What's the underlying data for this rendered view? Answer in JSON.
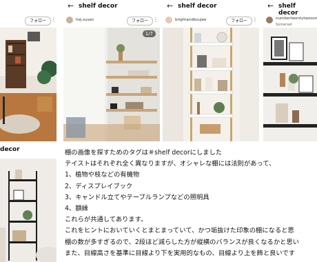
{
  "cards": [
    {
      "title": "",
      "user": "",
      "follow": "フォロー"
    },
    {
      "title": "shelf decor",
      "user": "hej.susan",
      "follow": "フォロー",
      "page_indicator": "1/7"
    },
    {
      "title": "shelf decor",
      "user": "brightandboujee",
      "follow": "フォロー"
    },
    {
      "title": "shelf decor",
      "user": "numbertwentytwosomers",
      "location": "Somerset",
      "follow": "フォロー"
    },
    {
      "title": "decor",
      "user": ""
    }
  ],
  "article": {
    "lines": [
      "棚の画像を探すためのタグは＃shelf decorにしました",
      "テイストはそれぞれ全く異なりますが、オシャレな棚には法則があって、",
      "1、植物や枝などの有機物",
      "2、ディスプレイブック",
      "3、キャンドル立てやテーブルランプなどの照明具",
      "4、額縁",
      "これらが共通してあります。",
      "これをヒントにおいていくとまとまっていて、かつ垢抜けた印象の棚になると思",
      "棚の数が多すぎるので、2段ほど減らした方が縦横のバランスが良くなるかと思い",
      "また、目線高さを基準に目線より下を実用的なもの、目線より上を飾と良いです"
    ]
  }
}
